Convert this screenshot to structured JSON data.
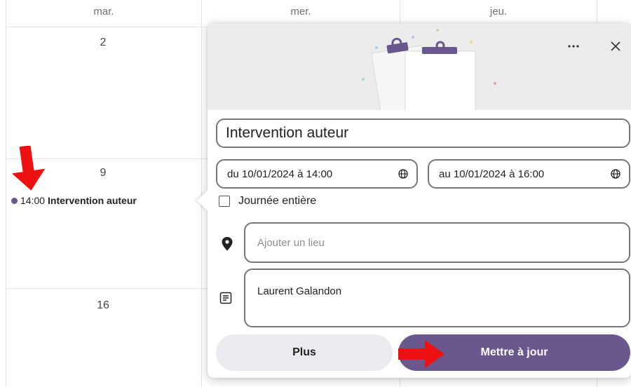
{
  "calendar": {
    "day_names": [
      "mar.",
      "mer.",
      "jeu."
    ],
    "day_numbers": [
      "2",
      "9",
      "16"
    ],
    "event": {
      "time": "14:00",
      "title": "Intervention auteur",
      "color": "#6a578d"
    }
  },
  "popup": {
    "more_icon": "more-horizontal-icon",
    "close_icon": "close-icon",
    "title": "Intervention auteur",
    "start": "du 10/01/2024 à 14:00",
    "end": "au 10/01/2024 à 16:00",
    "timezone_icon": "globe-icon",
    "all_day_label": "Journée entière",
    "all_day_checked": false,
    "location_placeholder": "Ajouter un lieu",
    "location_icon": "location-pin-icon",
    "notes": "Laurent Galandon",
    "notes_icon": "notes-icon",
    "more_button": "Plus",
    "update_button": "Mettre à jour",
    "accent_color": "#6a578d"
  },
  "annotations": {
    "arrow_color": "#ee1111"
  }
}
